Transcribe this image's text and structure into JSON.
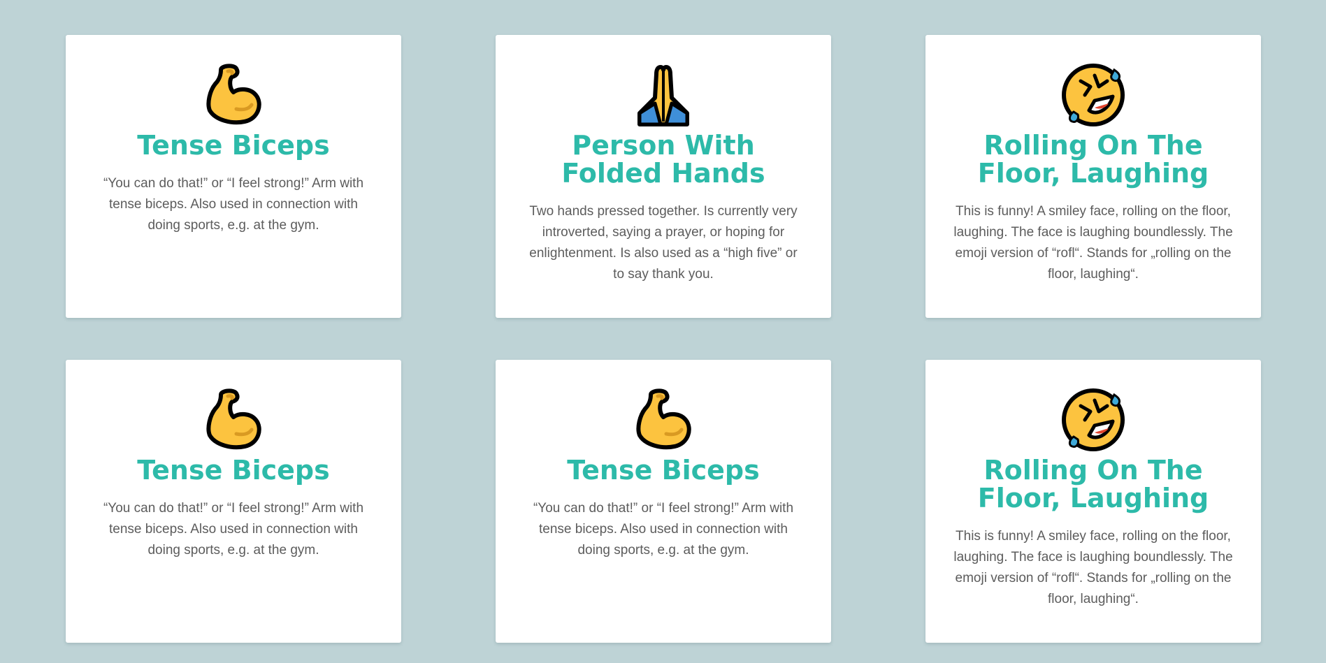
{
  "cards": [
    {
      "icon": "flexed-biceps-icon",
      "title": "Tense Biceps",
      "description": "“You can do that!” or “I feel strong!” Arm with tense biceps. Also used in connection with doing sports, e.g. at the gym."
    },
    {
      "icon": "folded-hands-icon",
      "title": "Person With Folded Hands",
      "description": "Two hands pressed together. Is currently very introverted, saying a prayer, or hoping for enlightenment. Is also used as a “high five” or to say thank you."
    },
    {
      "icon": "rolling-on-floor-laughing-icon",
      "title": "Rolling On The Floor, Laughing",
      "description": "This is funny! A smiley face, rolling on the floor, laughing. The face is laughing boundlessly. The emoji version of “rofl“. Stands for „rolling on the floor, laughing“."
    },
    {
      "icon": "flexed-biceps-icon",
      "title": "Tense Biceps",
      "description": "“You can do that!” or “I feel strong!” Arm with tense biceps. Also used in connection with doing sports, e.g. at the gym."
    },
    {
      "icon": "flexed-biceps-icon",
      "title": "Tense Biceps",
      "description": "“You can do that!” or “I feel strong!” Arm with tense biceps. Also used in connection with doing sports, e.g. at the gym."
    },
    {
      "icon": "rolling-on-floor-laughing-icon",
      "title": "Rolling On The Floor, Laughing",
      "description": "This is funny! A smiley face, rolling on the floor, laughing. The face is laughing boundlessly. The emoji version of “rofl“. Stands for „rolling on the floor, laughing“."
    }
  ],
  "colors": {
    "background": "#bed3d6",
    "card": "#ffffff",
    "title": "#2dbaa9",
    "text": "#5c5c5c",
    "emoji_yellow": "#fcc33f",
    "emoji_blue": "#3f8fd8",
    "tear_blue": "#3fa9d8"
  }
}
